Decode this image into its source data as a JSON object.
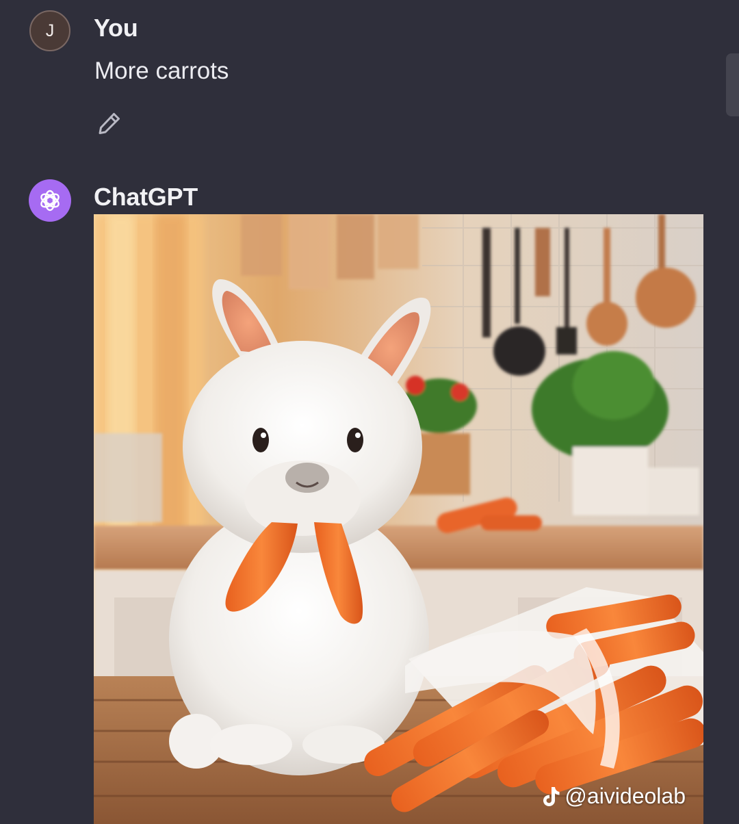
{
  "messages": [
    {
      "author": "You",
      "avatar_initial": "J",
      "text": "More carrots",
      "actions": [
        "pencil-icon"
      ]
    },
    {
      "author": "ChatGPT",
      "avatar_icon": "openai-logo-icon",
      "image": {
        "content": "generated-image",
        "watermark": "@aivideolab",
        "watermark_icon": "tiktok-icon"
      }
    }
  ],
  "colors": {
    "background": "#2f2f3b",
    "gpt_avatar": "#a66bf2",
    "user_avatar": "#4a3a36",
    "text": "#ececf1"
  }
}
